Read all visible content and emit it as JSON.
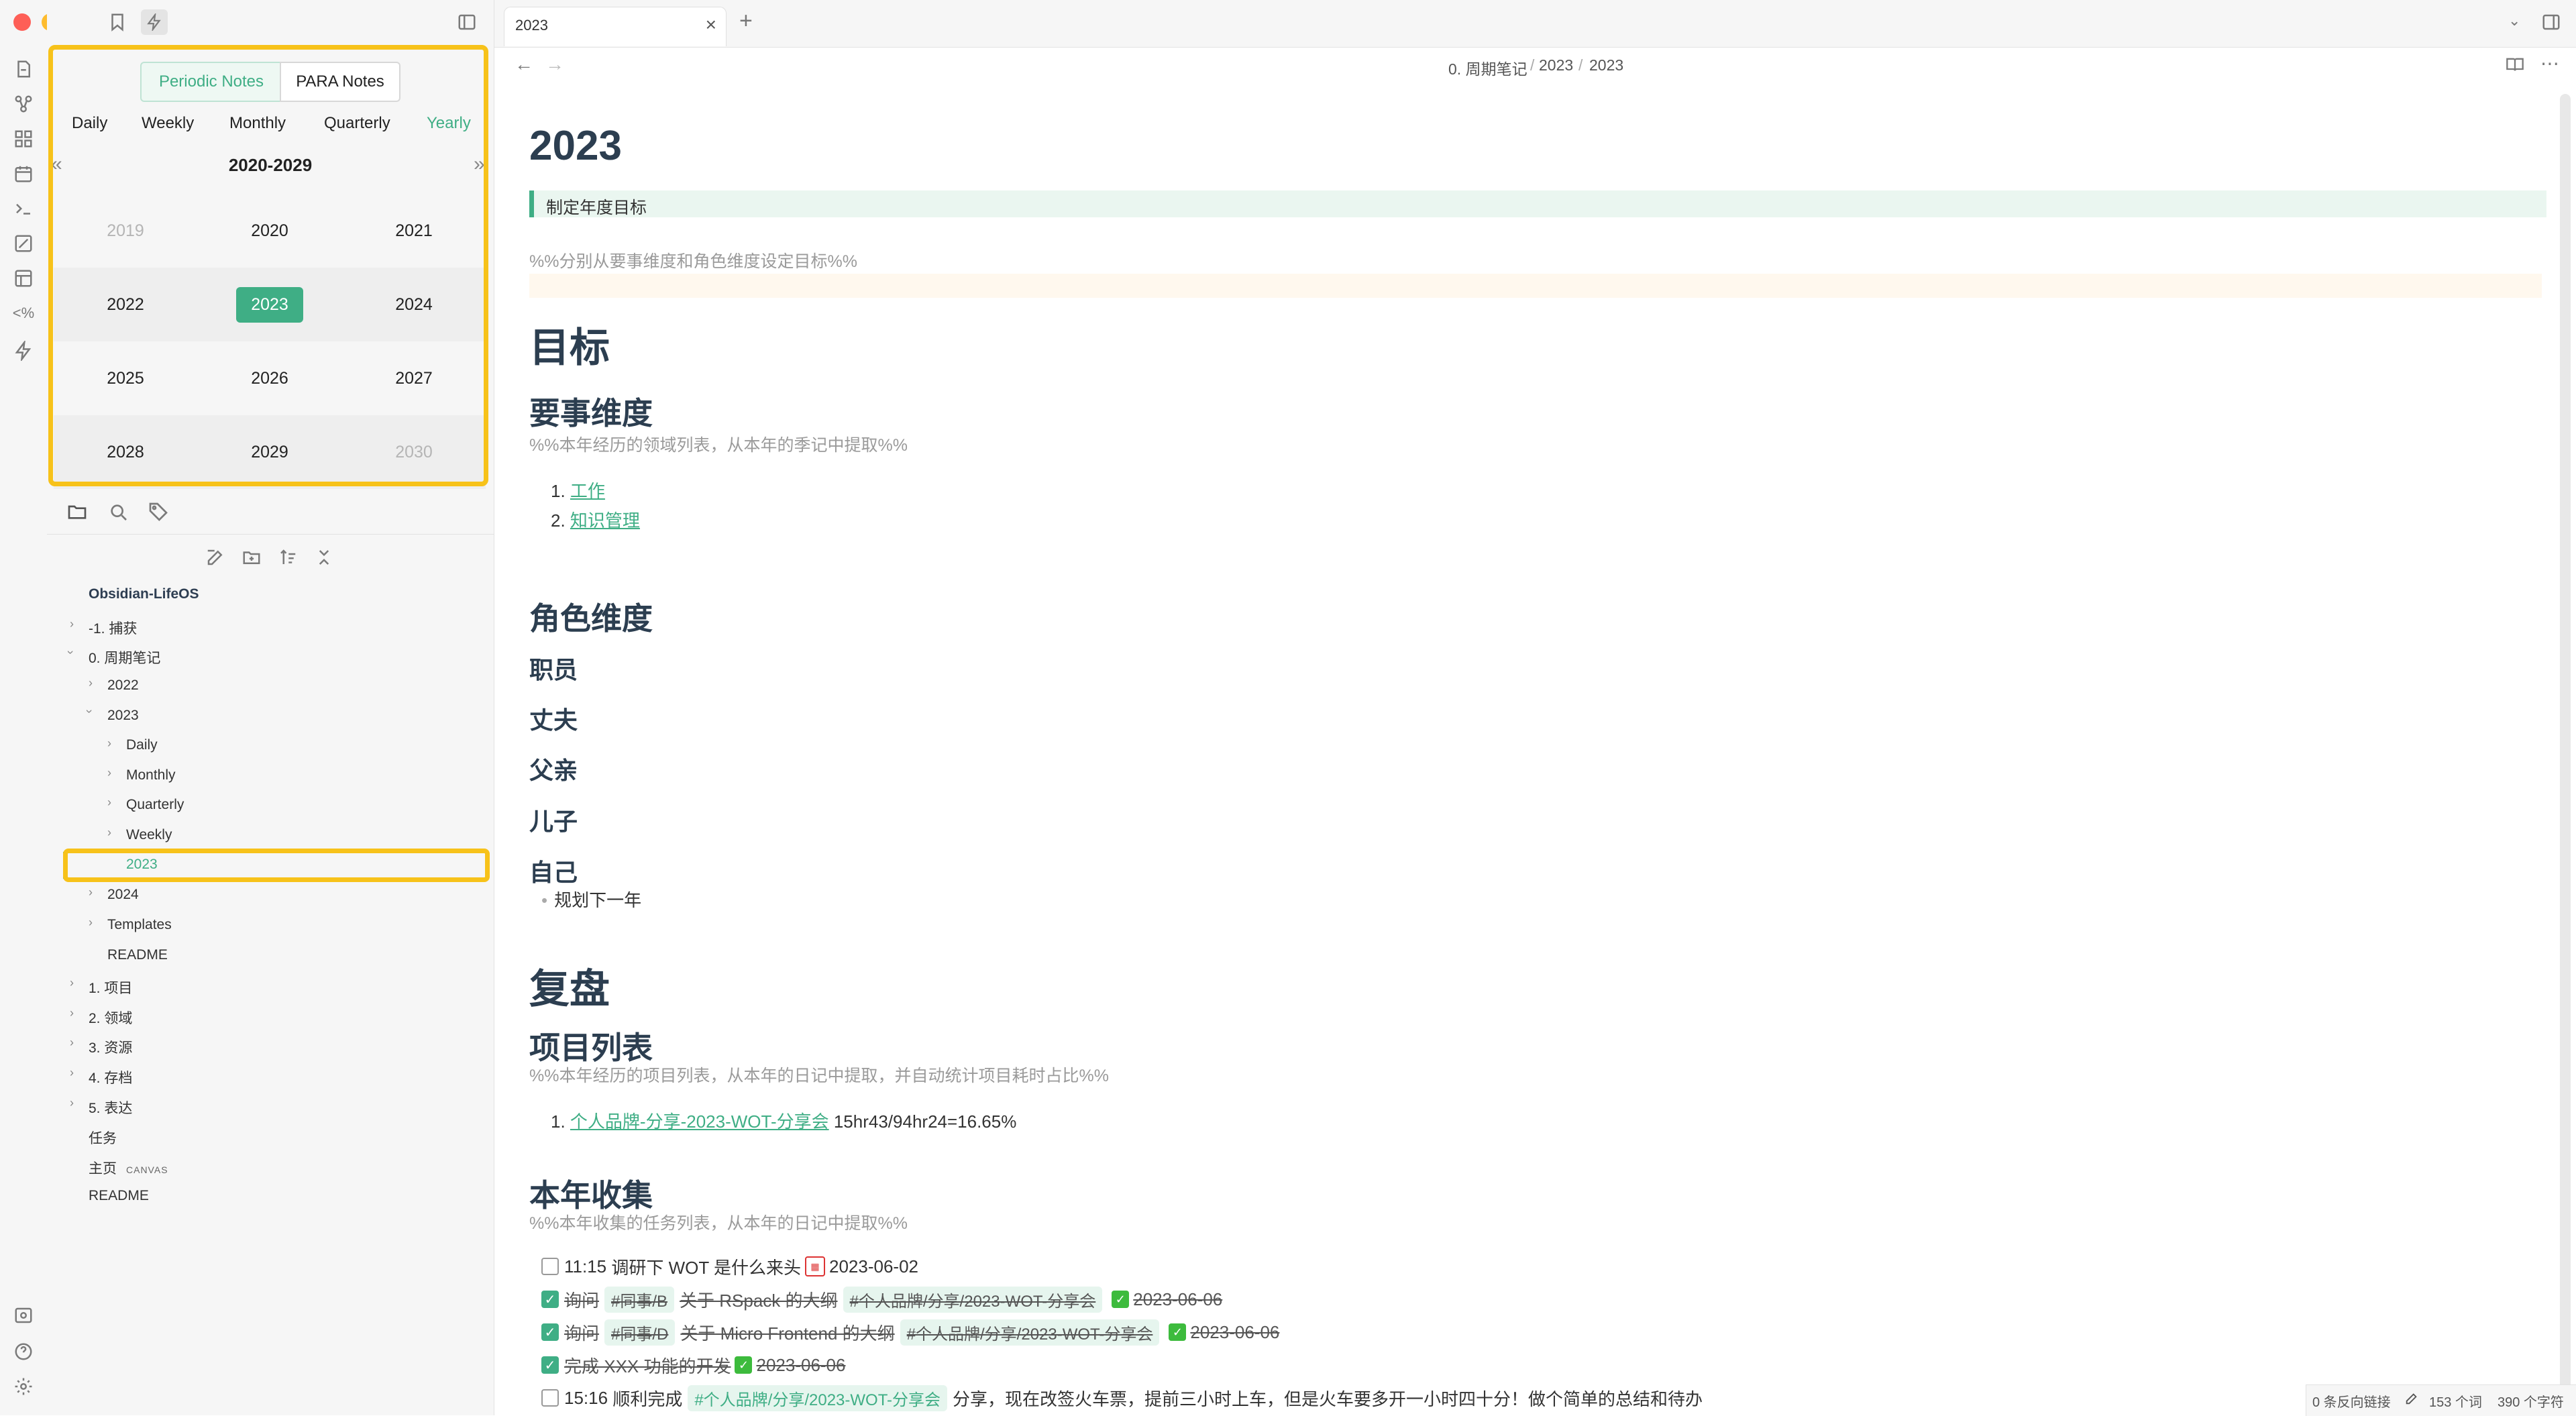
{
  "window": {
    "title": "2023"
  },
  "tabs": [
    {
      "label": "2023"
    }
  ],
  "breadcrumb": [
    "0. 周期笔记",
    "2023",
    "2023"
  ],
  "calendar": {
    "modes": [
      "Periodic Notes",
      "PARA Notes"
    ],
    "active_mode": "Periodic Notes",
    "periods": [
      "Daily",
      "Weekly",
      "Monthly",
      "Quarterly",
      "Yearly"
    ],
    "active_period": "Yearly",
    "decade": "2020-2029",
    "prev": "«",
    "next": "»",
    "years": [
      [
        "2019",
        "2020",
        "2021"
      ],
      [
        "2022",
        "2023",
        "2024"
      ],
      [
        "2025",
        "2026",
        "2027"
      ],
      [
        "2028",
        "2029",
        "2030"
      ]
    ],
    "selected_year": "2023"
  },
  "file_tree": {
    "vault": "Obsidian-LifeOS",
    "items": [
      {
        "label": "-1. 捕获"
      },
      {
        "label": "0. 周期笔记"
      },
      {
        "label": "2022"
      },
      {
        "label": "2023"
      },
      {
        "label": "Daily"
      },
      {
        "label": "Monthly"
      },
      {
        "label": "Quarterly"
      },
      {
        "label": "Weekly"
      },
      {
        "label": "2023"
      },
      {
        "label": "2024"
      },
      {
        "label": "Templates"
      },
      {
        "label": "README"
      },
      {
        "label": "1. 项目"
      },
      {
        "label": "2. 领域"
      },
      {
        "label": "3. 资源"
      },
      {
        "label": "4. 存档"
      },
      {
        "label": "5. 表达"
      },
      {
        "label": "任务"
      },
      {
        "label": "主页",
        "badge": "CANVAS"
      },
      {
        "label": "README"
      }
    ]
  },
  "note": {
    "title": "2023",
    "callout": "制定年度目标",
    "comment_top": "%%分别从要事维度和角色维度设定目标%%",
    "h_goals": "目标",
    "h_focus": "要事维度",
    "comment_focus": "%%本年经历的领域列表，从本年的季记中提取%%",
    "focus_list": [
      "工作",
      "知识管理"
    ],
    "h_roles": "角色维度",
    "roles": [
      "职员",
      "丈夫",
      "父亲",
      "儿子",
      "自己"
    ],
    "self_bullet": "规划下一年",
    "h_review": "复盘",
    "h_projects": "项目列表",
    "comment_projects": "%%本年经历的项目列表，从本年的日记中提取，并自动统计项目耗时占比%%",
    "project_link": "个人品牌-分享-2023-WOT-分享会",
    "project_stat": "15hr43/94hr24=16.65%",
    "h_collect": "本年收集",
    "comment_collect": "%%本年收集的任务列表，从本年的日记中提取%%",
    "tasks": [
      {
        "time": "11:15",
        "text": "调研下 WOT 是什么来头",
        "date": "2023-06-02",
        "done": false
      },
      {
        "prefix": "询问",
        "tag1": "#同事/B",
        "middle": "关于 RSpack 的大纲",
        "tag2": "#个人品牌/分享/2023-WOT-分享会",
        "date": "2023-06-06",
        "done": true
      },
      {
        "prefix": "询问",
        "tag1": "#同事/D",
        "middle": "关于 Micro Frontend 的大纲",
        "tag2": "#个人品牌/分享/2023-WOT-分享会",
        "date": "2023-06-06",
        "done": true
      },
      {
        "text": "完成 XXX 功能的开发",
        "date": "2023-06-06",
        "done": true
      },
      {
        "time": "15:16",
        "text": "顺利完成",
        "tag": "#个人品牌/分享/2023-WOT-分享会",
        "rest": "分享，现在改签火车票，提前三小时上车，但是火车要多开一小时四十分！做个简单的总结和待办",
        "done": false
      }
    ]
  },
  "status_bar": {
    "backlinks": "0 条反向链接",
    "words": "153 个词",
    "chars": "390 个字符"
  },
  "colors": {
    "accent": "#3fae85",
    "highlight": "#f7c21a"
  }
}
